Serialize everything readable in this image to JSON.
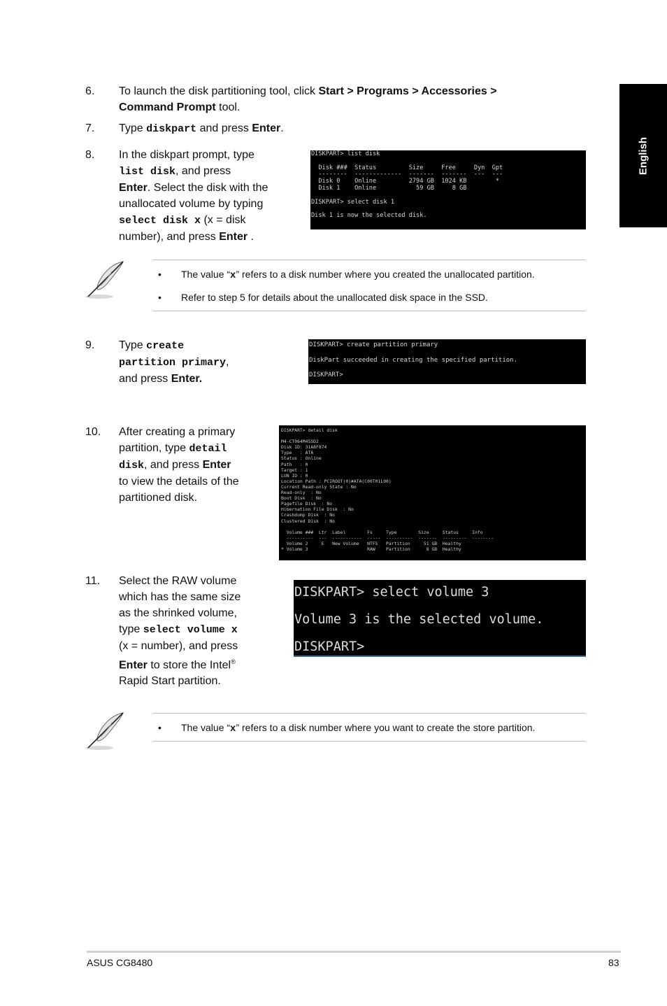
{
  "side_tab": {
    "label": "English"
  },
  "steps": {
    "s6": {
      "num": "6.",
      "t1": "To launch the disk partitioning tool, click ",
      "b1": "Start > Programs > Accessories >",
      "b2": "Command Prompt",
      "t2": " tool."
    },
    "s7": {
      "num": "7.",
      "t1": "Type ",
      "code": "diskpart",
      "t2": " and press ",
      "b1": "Enter",
      "t3": "."
    },
    "s8": {
      "num": "8.",
      "t1": "In the diskpart prompt, type",
      "code1": "list disk",
      "t2": ", and press",
      "b1": "Enter",
      "t3": ". Select the disk with the",
      "t4": "unallocated volume by typing",
      "code2": "select disk x",
      "t5": " (x = disk",
      "t6": "number), and press ",
      "b2": "Enter",
      "t7": " ."
    },
    "s9": {
      "num": "9.",
      "t1": "Type ",
      "code1": "create",
      "code2": "partition primary",
      "t2": ",",
      "t3": "and press ",
      "b1": "Enter."
    },
    "s10": {
      "num": "10.",
      "t1": "After creating a primary",
      "t2": "partition, type ",
      "code1": "detail",
      "code2": "disk",
      "t3": ", and press ",
      "b1": "Enter",
      "t4": "to view the details of the",
      "t5": "partitioned disk."
    },
    "s11": {
      "num": "11.",
      "t1": "Select the RAW volume",
      "t2": "which has the same size",
      "t3": "as the shrinked volume,",
      "t4": "type ",
      "code1": "select volume x",
      "t5": "(x = number), and press",
      "b1": "Enter",
      "t6": " to store the Intel",
      "reg": "®",
      "t7": "Rapid Start partition."
    }
  },
  "terminals": {
    "list_disk": [
      "DISKPART> list disk",
      "",
      "  Disk ###  Status         Size     Free     Dyn  Gpt",
      "  --------  -------------  -------  -------  ---  ---",
      "  Disk 0    Online         2794 GB  1024 KB        *",
      "  Disk 1    Online           59 GB     8 GB",
      "",
      "DISKPART> select disk 1",
      "",
      "Disk 1 is now the selected disk."
    ],
    "create_partition": [
      "DISKPART> create partition primary",
      "",
      "DiskPart succeeded in creating the specified partition.",
      "",
      "DISKPART>"
    ],
    "detail_disk": [
      "DISKPART> detail disk",
      "",
      "M4-CT064M4SSD2",
      "Disk ID: 31A8F874",
      "Type   : ATA",
      "Status : Online",
      "Path   : 0",
      "Target : 1",
      "LUN ID : 0",
      "Location Path : PCIROOT(0)#ATA(C00T01L00)",
      "Current Read-only State : No",
      "Read-only  : No",
      "Boot Disk  : No",
      "Pagefile Disk  : No",
      "Hibernation File Disk  : No",
      "Crashdump Disk  : No",
      "Clustered Disk  : No",
      "",
      "  Volume ###  Ltr  Label        Fs     Type        Size     Status     Info",
      "  ----------  ---  -----------  -----  ----------  -------  ---------  --------",
      "  Volume 2     E   New Volume   NTFS   Partition     51 GB  Healthy",
      "* Volume 3                      RAW    Partition      8 GB  Healthy"
    ],
    "select_volume": [
      "DISKPART> select volume 3",
      "",
      "Volume 3 is the selected volume.",
      "",
      "DISKPART>"
    ]
  },
  "notes": {
    "note1": {
      "items": [
        {
          "bullet": "•",
          "pre": "The value “",
          "x": "x",
          "post": "” refers to a disk number where you created the unallocated partition."
        },
        {
          "bullet": "•",
          "text": "Refer to step 5 for details about the unallocated disk space in the SSD."
        }
      ]
    },
    "note2": {
      "items": [
        {
          "bullet": "•",
          "pre": "The value “",
          "x": "x",
          "post": "” refers to a disk number where you want to create the store partition."
        }
      ]
    },
    "icon": "feather-note-icon"
  },
  "footer": {
    "product": "ASUS CG8480",
    "page": "83"
  }
}
